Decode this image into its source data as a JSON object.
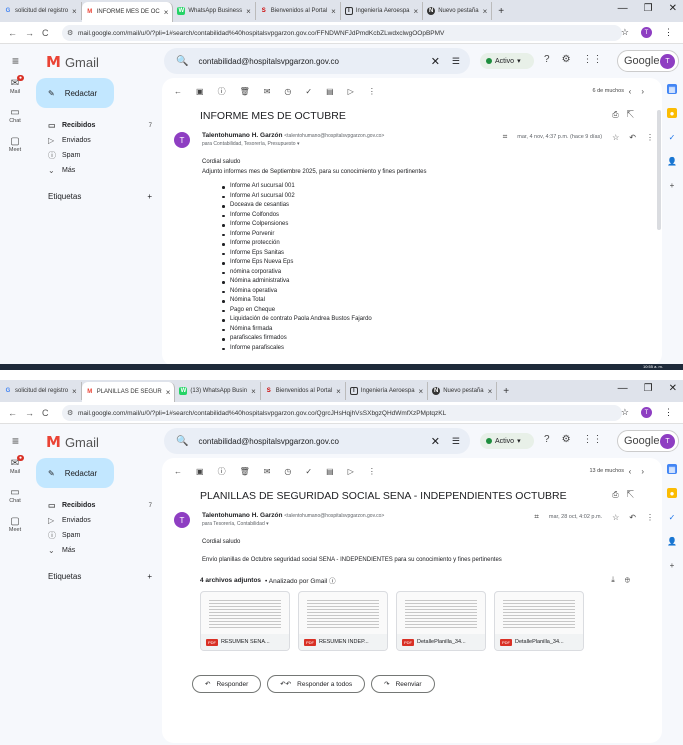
{
  "colors": {
    "accent": "#c2e7ff",
    "avatar": "#8e3ec2",
    "gmail_red": "#ea4335",
    "active_green": "#1e8e3e"
  },
  "shot1": {
    "tabs": [
      {
        "label": "solicitud del registro",
        "icon": "G"
      },
      {
        "label": "INFORME MES DE OC",
        "icon": "M"
      },
      {
        "label": "WhatsApp Business",
        "icon": "W"
      },
      {
        "label": "Bienvenidos al Portal",
        "icon": "S"
      },
      {
        "label": "Ingeniería Aeroespa",
        "icon": "I"
      },
      {
        "label": "Nuevo pestaña",
        "icon": "N"
      }
    ],
    "url": "mail.google.com/mail/u/0/?pli=1#search/contabilidad%40hospitalsvpgarzon.gov.co/FFNDWNFJdPmdKcbZLwdxclwgOOpBPMV",
    "search_value": "contabilidad@hospitalsvpgarzon.gov.co",
    "status": "Activo",
    "pager": "6 de muchos",
    "subject": "INFORME MES DE OCTUBRE",
    "sender_name": "Talentohumano H. Garzón",
    "sender_email": "<talentohumano@hospitalsvpgarzon.gov.co>",
    "to": "para Contabilidad, Tesorería, Presupuesto ▾",
    "date": "mar, 4 nov, 4:37 p.m. (hace 9 días)",
    "greeting": "Cordial saludo",
    "intro": "Adjunto informes mes de Septiembre  2025, para su conocimiento y fines pertinentes",
    "items": [
      "Informe Arl sucursal 001",
      "Informe Arl sucursal 002",
      "Doceava de cesantias",
      "Informe Colfondos",
      "Informe Colpensiones",
      "Informe Porvenir",
      "Informe protección",
      "Informe Eps Sanitas",
      "Informe Eps Nueva Eps",
      "nómina corporativa",
      "Nómina administrativa",
      "Nómina operativa",
      "Nómina Total",
      "Pago en Cheque",
      "Liquidación de contrato Paola Andrea Bustos Fajardo",
      "Nómina firmada",
      "parafiscales firmados",
      "Informe parafiscales"
    ],
    "taskbar_time": "10:55 a. m."
  },
  "shot2": {
    "tabs": [
      {
        "label": "solicitud del registro",
        "icon": "G"
      },
      {
        "label": "PLANILLAS DE SEGUR",
        "icon": "M"
      },
      {
        "label": "(13) WhatsApp Busin",
        "icon": "W"
      },
      {
        "label": "Bienvenidos al Portal",
        "icon": "S"
      },
      {
        "label": "Ingeniería Aeroespa",
        "icon": "I"
      },
      {
        "label": "Nuevo pestaña",
        "icon": "N"
      }
    ],
    "url": "mail.google.com/mail/u/0/?pli=1#search/contabilidad%40hospitalsvpgarzon.gov.co/QgrcJHsHqjhVsSXbgzQHdWmfXzPMptqzKL",
    "search_value": "contabilidad@hospitalsvpgarzon.gov.co",
    "status": "Activo",
    "pager": "13 de muchos",
    "subject": "PLANILLAS DE SEGURIDAD SOCIAL SENA - INDEPENDIENTES OCTUBRE",
    "sender_name": "Talentohumano H. Garzón",
    "sender_email": "<talentohumano@hospitalsvpgarzon.gov.co>",
    "to": "para Tesorería, Contabilidad ▾",
    "date": "mar, 28 oct, 4:02 p.m.",
    "greeting": "Cordial saludo",
    "intro": "Envío planillas de Octubre seguridad social  SENA - INDEPENDIENTES para su conocimiento y fines pertinentes",
    "attachments_count": "4 archivos adjuntos",
    "analyzed": "• Analizado por Gmail ⓘ",
    "attachments": [
      "RESUMEN SENA...",
      "RESUMEN INDEP...",
      "DetallePlanilla_34...",
      "DetallePlanilla_34..."
    ],
    "reply": "Responder",
    "reply_all": "Responder a todos",
    "forward": "Reenviar"
  },
  "common": {
    "app_name": "Gmail",
    "compose": "Redactar",
    "folders": [
      {
        "label": "Recibidos",
        "count": "7"
      },
      {
        "label": "Enviados",
        "count": ""
      },
      {
        "label": "Spam",
        "count": ""
      },
      {
        "label": "Más",
        "count": ""
      }
    ],
    "labels_title": "Etiquetas",
    "rail": [
      "Mail",
      "Chat",
      "Meet"
    ],
    "google": "Google",
    "user_initial": "T",
    "pdf": "PDF"
  }
}
